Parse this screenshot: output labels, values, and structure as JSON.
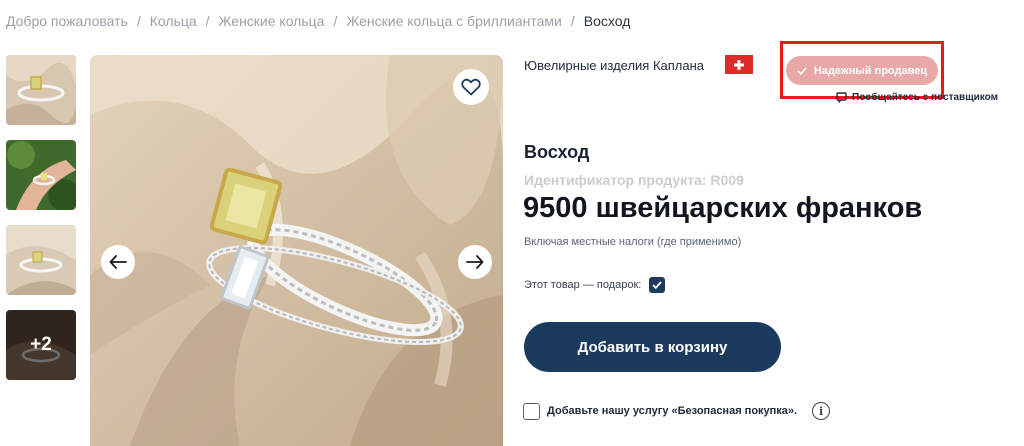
{
  "breadcrumb": {
    "items": [
      "Добро пожаловать",
      "Кольца",
      "Женские кольца",
      "Женские кольца с бриллиантами"
    ],
    "current": "Восход",
    "separator": "/"
  },
  "gallery": {
    "thumbnails": [
      "thumb-image-1",
      "thumb-image-2",
      "thumb-image-3",
      "thumb-image-4"
    ],
    "more_label": "+2",
    "icons": {
      "favorite": "heart-icon",
      "prev": "arrow-left-icon",
      "next": "arrow-right-icon"
    }
  },
  "seller": {
    "name": "Ювелирные изделия Каплана",
    "flag": "swiss-flag-icon",
    "trusted_label": "Надежный продавец",
    "contact_label": "Пообщайтесь с поставщиком"
  },
  "product": {
    "title": "Восход",
    "id_label": "Идентификатор продукта: R009",
    "price": "9500 швейцарских франков",
    "tax_note": "Включая местные налоги (где применимо)",
    "gift_label": "Этот товар — подарок:",
    "gift_checked": true,
    "add_to_cart": "Добавить в корзину",
    "safe_purchase_label": "Добавьте нашу услугу «Безопасная покупка».",
    "safe_purchase_checked": false,
    "info_glyph": "i"
  },
  "colors": {
    "primary": "#1b3a5e",
    "trusted_badge": "#e9a8a8",
    "highlight_border": "#e8191c",
    "flag_red": "#e02b2b"
  }
}
